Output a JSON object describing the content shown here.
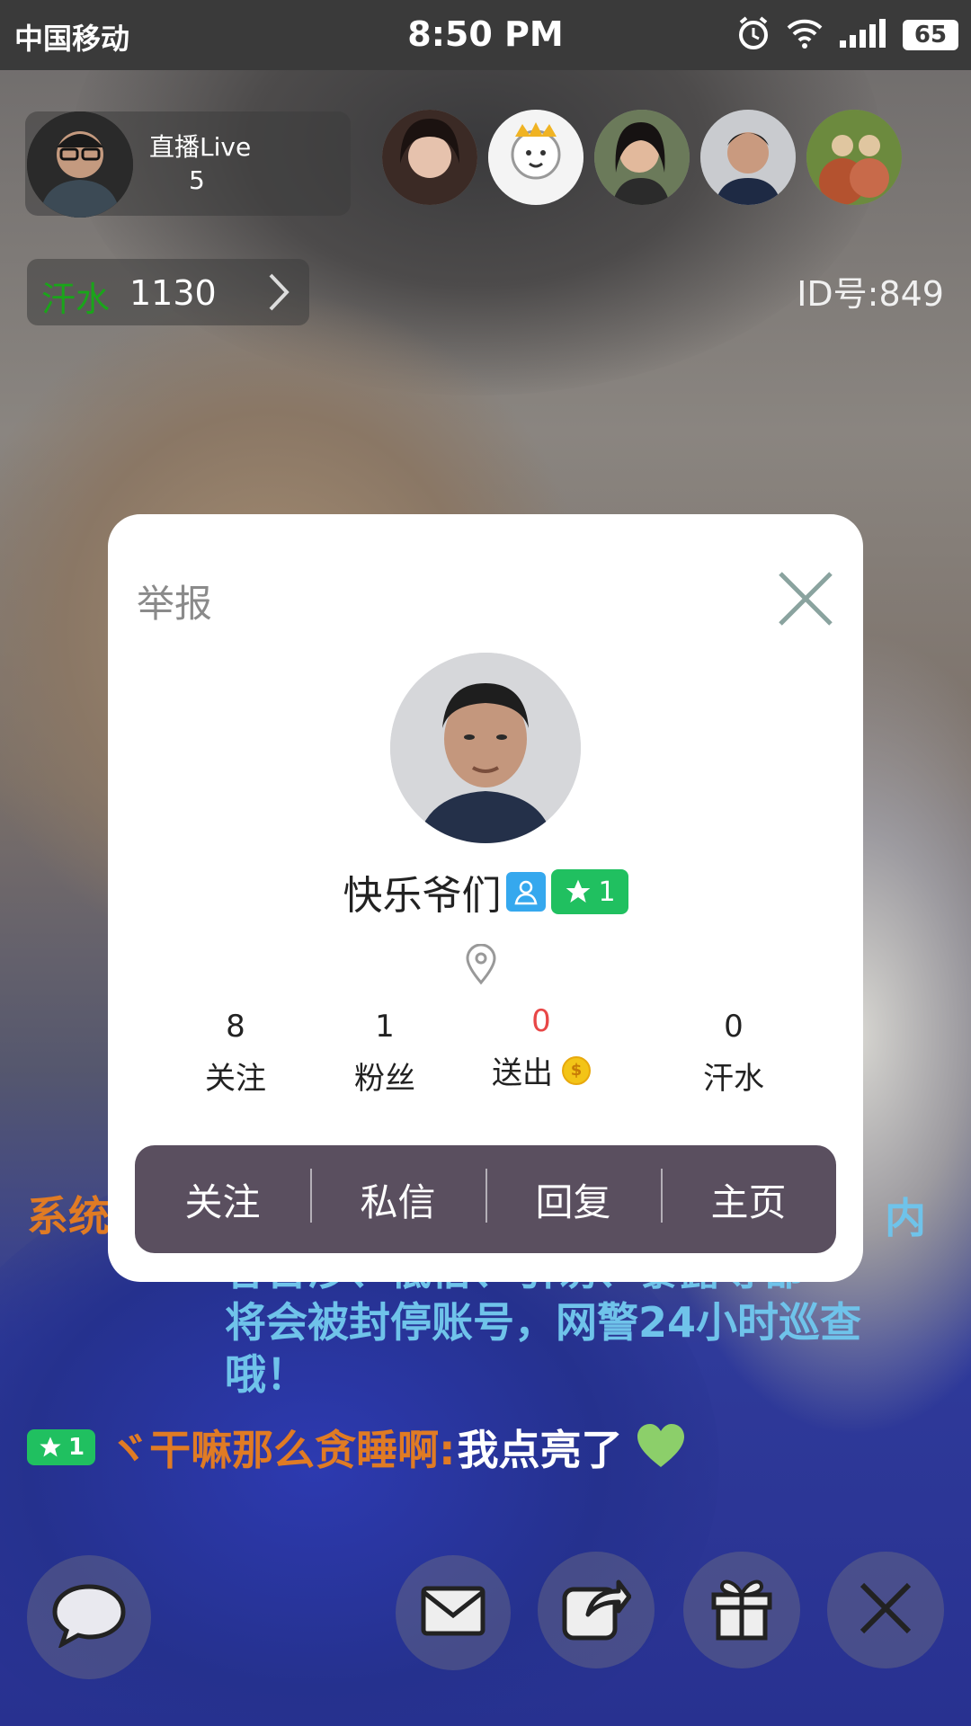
{
  "status_bar": {
    "carrier": "中国移动",
    "time": "8:50 PM",
    "battery": "65"
  },
  "host": {
    "name": "直播Live",
    "viewer_count": "5"
  },
  "sweat": {
    "label": "汗水",
    "value": "1130"
  },
  "room": {
    "id_text": "ID号:849"
  },
  "chat": {
    "system_label": "系统",
    "system_lines": [
      "内",
      "容含涉、低俗、引诱、暴露等都",
      "将会被封停账号，网警24小时巡查",
      "哦！"
    ],
    "user_level": "1",
    "user_name": "ヾ干嘛那么贪睡啊:",
    "user_message": "我点亮了"
  },
  "profile_modal": {
    "report_label": "举报",
    "username": "快乐爷们",
    "level": "1",
    "stats": [
      {
        "value": "8",
        "label": "关注"
      },
      {
        "value": "1",
        "label": "粉丝"
      },
      {
        "value": "0",
        "label": "送出"
      },
      {
        "value": "0",
        "label": "汗水"
      }
    ],
    "actions": [
      "关注",
      "私信",
      "回复",
      "主页"
    ]
  },
  "colors": {
    "sweat_label": "#1aa51a",
    "level_badge": "#20c060",
    "chat_orange": "#e07b24",
    "chat_blue": "#6fc3ea",
    "sent_red": "#e84747",
    "action_bar": "#5a4f5f"
  },
  "icons": [
    "alarm-icon",
    "wifi-icon",
    "signal-icon",
    "chevron-right-icon",
    "close-icon",
    "user-role-icon",
    "star-icon",
    "location-pin-icon",
    "coin-icon",
    "heart-icon",
    "chat-bubble-icon",
    "mail-icon",
    "share-icon",
    "gift-icon"
  ]
}
